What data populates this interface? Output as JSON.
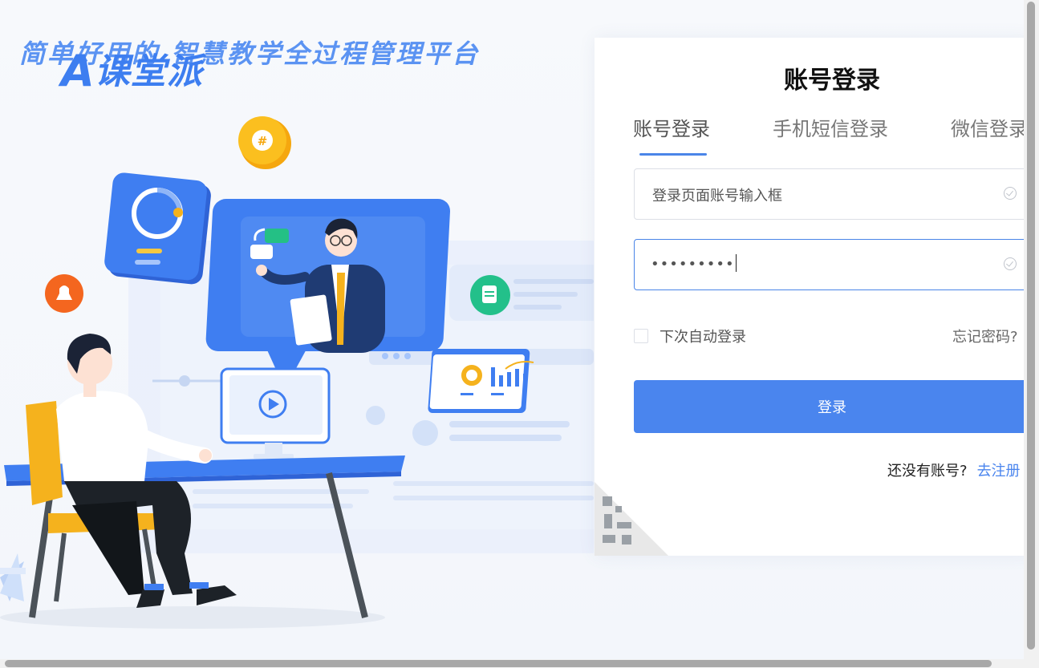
{
  "hero": {
    "slogan": "简单好用的  智慧教学全过程管理平台",
    "logo_mark": "A",
    "logo_text": "课堂派"
  },
  "login": {
    "title": "账号登录",
    "tabs": [
      {
        "label": "账号登录",
        "active": true
      },
      {
        "label": "手机短信登录",
        "active": false
      },
      {
        "label": "微信登录",
        "active": false
      }
    ],
    "account_input": {
      "value": "登录页面账号输入框"
    },
    "password_input": {
      "value": "•••••••••"
    },
    "remember_label": "下次自动登录",
    "forgot_label": "忘记密码?",
    "submit_label": "登录",
    "register_prompt": "还没有账号?",
    "register_link": "去注册"
  },
  "colors": {
    "accent": "#4a85ee",
    "slogan": "#5b93f2"
  }
}
